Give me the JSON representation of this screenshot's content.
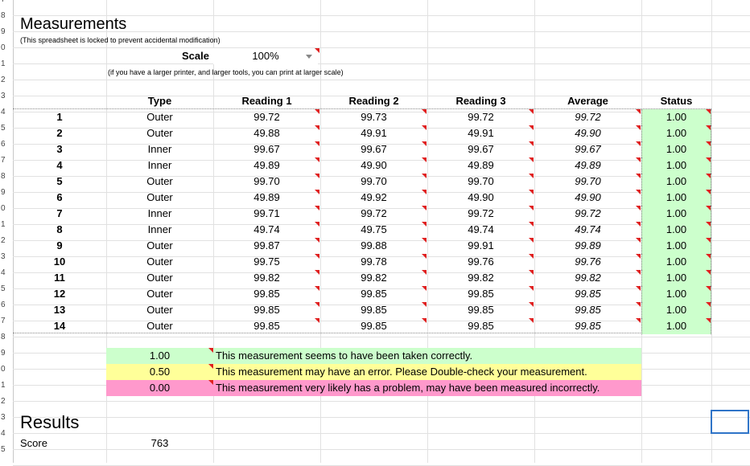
{
  "row_numbers": [
    "7",
    "8",
    "9",
    "0",
    "1",
    "2",
    "3",
    "4",
    "5",
    "6",
    "7",
    "8",
    "9",
    "0",
    "1",
    "2",
    "3",
    "4",
    "5",
    "6",
    "7",
    "8",
    "9",
    "0",
    "1",
    "2",
    "3",
    "4",
    "5"
  ],
  "header": {
    "title": "Measurements",
    "lock_note": "(This spreadsheet is locked to prevent accidental modification)",
    "scale_label": "Scale",
    "scale_value": "100%",
    "scale_note": "(if you have a larger printer, and larger tools, you can print at larger scale)"
  },
  "table": {
    "columns": [
      "Type",
      "Reading 1",
      "Reading 2",
      "Reading 3",
      "Average",
      "Status"
    ],
    "rows": [
      {
        "n": "1",
        "type": "Outer",
        "r1": "99.72",
        "r2": "99.73",
        "r3": "99.72",
        "avg": "99.72",
        "status": "1.00"
      },
      {
        "n": "2",
        "type": "Outer",
        "r1": "49.88",
        "r2": "49.91",
        "r3": "49.91",
        "avg": "49.90",
        "status": "1.00"
      },
      {
        "n": "3",
        "type": "Inner",
        "r1": "99.67",
        "r2": "99.67",
        "r3": "99.67",
        "avg": "99.67",
        "status": "1.00"
      },
      {
        "n": "4",
        "type": "Inner",
        "r1": "49.89",
        "r2": "49.90",
        "r3": "49.89",
        "avg": "49.89",
        "status": "1.00"
      },
      {
        "n": "5",
        "type": "Outer",
        "r1": "99.70",
        "r2": "99.70",
        "r3": "99.70",
        "avg": "99.70",
        "status": "1.00"
      },
      {
        "n": "6",
        "type": "Outer",
        "r1": "49.89",
        "r2": "49.92",
        "r3": "49.90",
        "avg": "49.90",
        "status": "1.00"
      },
      {
        "n": "7",
        "type": "Inner",
        "r1": "99.71",
        "r2": "99.72",
        "r3": "99.72",
        "avg": "99.72",
        "status": "1.00"
      },
      {
        "n": "8",
        "type": "Inner",
        "r1": "49.74",
        "r2": "49.75",
        "r3": "49.74",
        "avg": "49.74",
        "status": "1.00"
      },
      {
        "n": "9",
        "type": "Outer",
        "r1": "99.87",
        "r2": "99.88",
        "r3": "99.91",
        "avg": "99.89",
        "status": "1.00"
      },
      {
        "n": "10",
        "type": "Outer",
        "r1": "99.75",
        "r2": "99.78",
        "r3": "99.76",
        "avg": "99.76",
        "status": "1.00"
      },
      {
        "n": "11",
        "type": "Outer",
        "r1": "99.82",
        "r2": "99.82",
        "r3": "99.82",
        "avg": "99.82",
        "status": "1.00"
      },
      {
        "n": "12",
        "type": "Outer",
        "r1": "99.85",
        "r2": "99.85",
        "r3": "99.85",
        "avg": "99.85",
        "status": "1.00"
      },
      {
        "n": "13",
        "type": "Outer",
        "r1": "99.85",
        "r2": "99.85",
        "r3": "99.85",
        "avg": "99.85",
        "status": "1.00"
      },
      {
        "n": "14",
        "type": "Outer",
        "r1": "99.85",
        "r2": "99.85",
        "r3": "99.85",
        "avg": "99.85",
        "status": "1.00"
      }
    ]
  },
  "legend": [
    {
      "value": "1.00",
      "text": "This measurement seems to have been taken correctly.",
      "color": "#ccffcc"
    },
    {
      "value": "0.50",
      "text": "This measurement may have an error. Please Double-check your measurement.",
      "color": "#ffff99"
    },
    {
      "value": "0.00",
      "text": "This measurement very likely has a problem, may have been measured incorrectly.",
      "color": "#ff99cc"
    }
  ],
  "results": {
    "title": "Results",
    "score_label": "Score",
    "score_value": "763"
  },
  "colors": {
    "comment_marker": "#e02020",
    "selection": "#2f74c8"
  }
}
